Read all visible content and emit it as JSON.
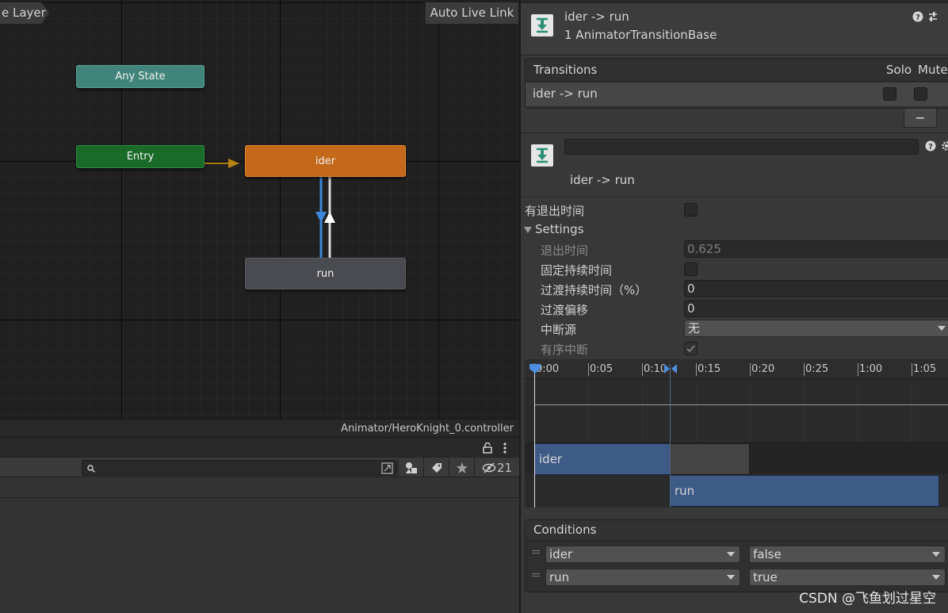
{
  "graph": {
    "breadcrumb": "e Layer",
    "auto_live_link": "Auto Live Link",
    "nodes": {
      "any_state": "Any State",
      "entry": "Entry",
      "ider": "ider",
      "run": "run"
    },
    "footer_path": "Animator/HeroKnight_0.controller",
    "colors": {
      "any_state": "#41857a",
      "entry": "#1a6b2a",
      "ider_default": "#c4691a",
      "run": "#4a4b50",
      "transition_selected": "#3c87d8"
    }
  },
  "project": {
    "search": {
      "placeholder": "",
      "value": ""
    },
    "hidden_count": "21",
    "icons": [
      "lock-icon",
      "kebab-menu-icon",
      "search-icon",
      "filter-by-type-icon",
      "filter-by-label-icon",
      "favorite-star-icon",
      "hidden-packages-icon"
    ]
  },
  "inspector": {
    "header": {
      "title": "ider -> run",
      "subtitle": "1 AnimatorTransitionBase",
      "icons": [
        "help-icon",
        "preset-icon"
      ]
    },
    "transitions": {
      "heading": "Transitions",
      "solo_label": "Solo",
      "mute_label": "Mute",
      "rows": [
        {
          "name": "ider -> run",
          "solo": false,
          "mute": false
        }
      ],
      "remove_label": "−"
    },
    "transition_editor": {
      "name_field": "",
      "title": "ider -> run",
      "icons": [
        "help-icon",
        "settings-gear-icon"
      ],
      "has_exit_time_label": "有退出时间",
      "has_exit_time": false,
      "settings_label": "Settings",
      "exit_time_label": "退出时间",
      "exit_time": "0.625",
      "fixed_duration_label": "固定持续时间",
      "fixed_duration": false,
      "transition_duration_label": "过渡持续时间（%）",
      "transition_duration": "0",
      "transition_offset_label": "过渡偏移",
      "transition_offset": "0",
      "interruption_source_label": "中断源",
      "interruption_source": "无",
      "ordered_interruption_label": "有序中断",
      "ordered_interruption": true
    },
    "timeline": {
      "ticks": [
        "0:00",
        "0:05",
        "0:10",
        "0:15",
        "0:20",
        "0:25",
        "1:00",
        "1:05"
      ],
      "tracks": [
        {
          "name": "ider"
        },
        {
          "name": "run"
        }
      ]
    },
    "conditions": {
      "heading": "Conditions",
      "rows": [
        {
          "parameter": "ider",
          "value": "false"
        },
        {
          "parameter": "run",
          "value": "true"
        }
      ]
    }
  },
  "watermark": "CSDN @飞鱼划过星空"
}
